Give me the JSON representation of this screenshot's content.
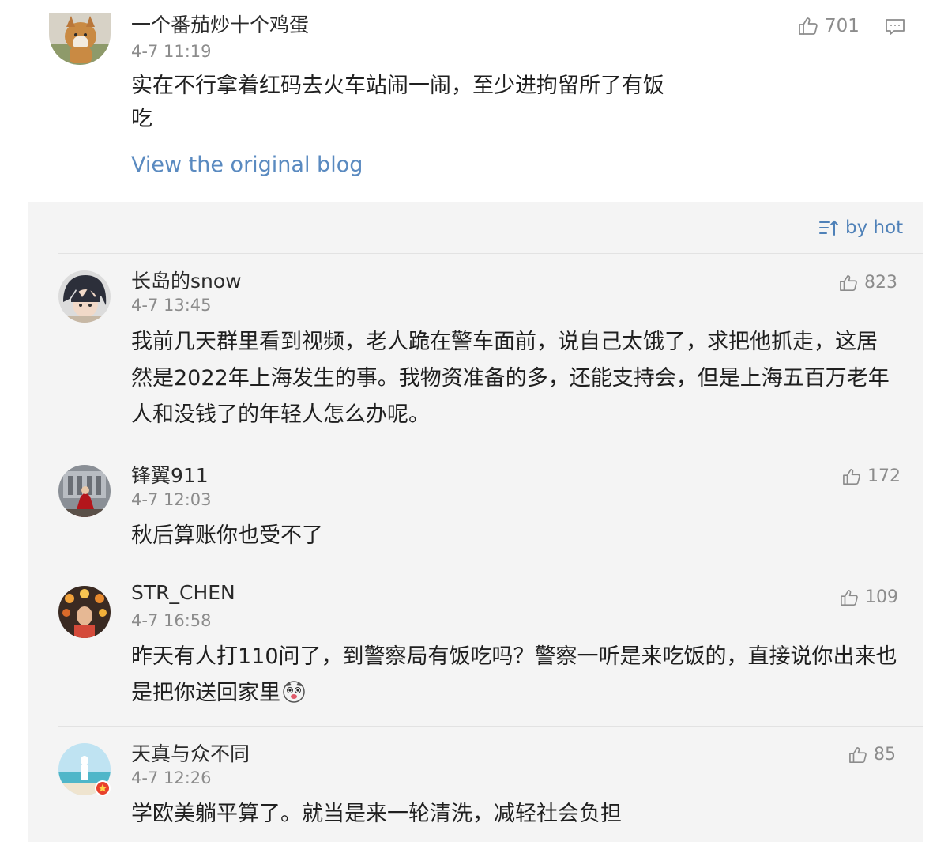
{
  "main_comment": {
    "username": "一个番茄炒十个鸡蛋",
    "time": "4-7 11:19",
    "likes": "701",
    "text": "实在不行拿着红码去火车站闹一闹，至少进拘留所了有饭吃",
    "view_original_label": "View the original blog"
  },
  "sort": {
    "label": "by hot"
  },
  "replies": [
    {
      "username": "长岛的snow",
      "time": "4-7 13:45",
      "likes": "823",
      "text": "我前几天群里看到视频，老人跪在警车面前，说自己太饿了，求把他抓走，这居然是2022年上海发生的事。我物资准备的多，还能支持会，但是上海五百万老年人和没钱了的年轻人怎么办呢。"
    },
    {
      "username": "锋翼911",
      "time": "4-7 12:03",
      "likes": "172",
      "text": "秋后算账你也受不了"
    },
    {
      "username": "STR_CHEN",
      "time": "4-7 16:58",
      "likes": "109",
      "text": "昨天有人打110问了，到警察局有饭吃吗？警察一听是来吃饭的，直接说你出来也是把你送回家里"
    },
    {
      "username": "天真与众不同",
      "time": "4-7 12:26",
      "likes": "85",
      "text": "学欧美躺平算了。就当是来一轮清洗，减轻社会负担"
    }
  ],
  "colors": {
    "link": "#5a8ac0",
    "sort": "#4f81b8",
    "meta": "#8c8c8c",
    "panel": "#f4f4f4"
  },
  "icons": {
    "like": "thumbs-up-icon",
    "reply": "comment-icon",
    "sort": "sort-icon",
    "emoji": "face-emoji-icon",
    "badge": "verified-badge-icon"
  }
}
